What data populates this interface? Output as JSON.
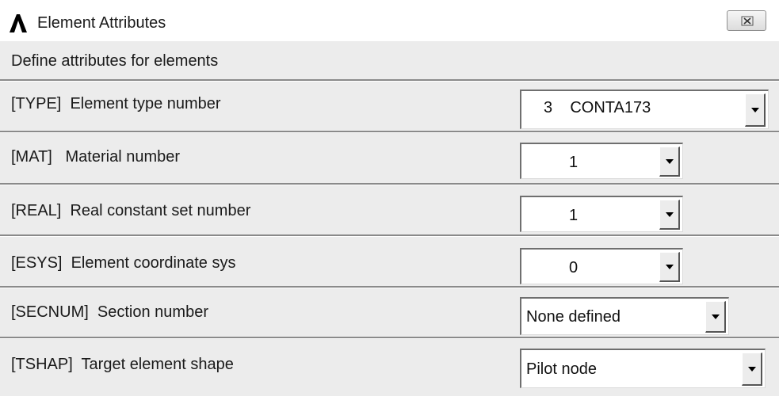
{
  "window": {
    "title": "Element Attributes",
    "logo_icon": "ansys-logo-icon",
    "close_icon": "close-icon"
  },
  "header": {
    "subtitle": "Define attributes for elements"
  },
  "fields": {
    "type": {
      "label": "[TYPE]  Element type number",
      "value": "3    CONTA173"
    },
    "mat": {
      "label": "[MAT]   Material number",
      "value": "1"
    },
    "real": {
      "label": "[REAL]  Real constant set number",
      "value": "1"
    },
    "esys": {
      "label": "[ESYS]  Element coordinate sys",
      "value": "0"
    },
    "secnum": {
      "label": "[SECNUM]  Section number",
      "value": "None defined"
    },
    "tshap": {
      "label": "[TSHAP]  Target element shape",
      "value": "Pilot node"
    }
  },
  "colors": {
    "dialog_bg": "#ececec",
    "titlebar_bg": "#ffffff",
    "separator": "#8a8a8a"
  }
}
